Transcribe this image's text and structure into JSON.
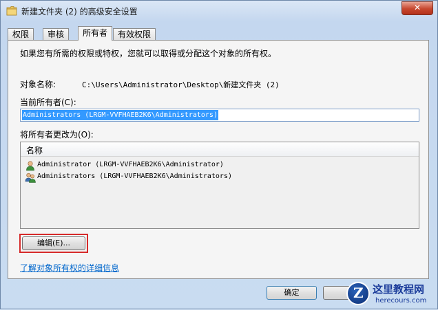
{
  "window": {
    "title": "新建文件夹 (2) 的高级安全设置",
    "close_label": "✕"
  },
  "tabs": [
    {
      "label": "权限",
      "active": false
    },
    {
      "label": "审核",
      "active": false
    },
    {
      "label": "所有者",
      "active": true
    },
    {
      "label": "有效权限",
      "active": false
    }
  ],
  "owner_page": {
    "instruction": "如果您有所需的权限或特权，您就可以取得或分配这个对象的所有权。",
    "object_name_label": "对象名称:",
    "object_name_value": "C:\\Users\\Administrator\\Desktop\\新建文件夹 (2)",
    "current_owner_label": "当前所有者(C):",
    "current_owner_value": "Administrators (LRGM-VVFHAEB2K6\\Administrators)",
    "change_owner_label": "将所有者更改为(O):",
    "list_header": "名称",
    "owner_options": [
      {
        "name": "Administrator (LRGM-VVFHAEB2K6\\Administrator)",
        "icon": "user-icon"
      },
      {
        "name": "Administrators (LRGM-VVFHAEB2K6\\Administrators)",
        "icon": "group-icon"
      }
    ],
    "edit_button": "编辑(E)...",
    "learn_more_link": "了解对象所有权的详细信息"
  },
  "footer": {
    "ok_button": "确定"
  },
  "watermark": {
    "logo_letter": "Z",
    "title": "这里教程网",
    "url": "herecours.com"
  },
  "colors": {
    "selection": "#3399ff",
    "link": "#0066cc",
    "highlight_frame": "#d62a2a"
  }
}
